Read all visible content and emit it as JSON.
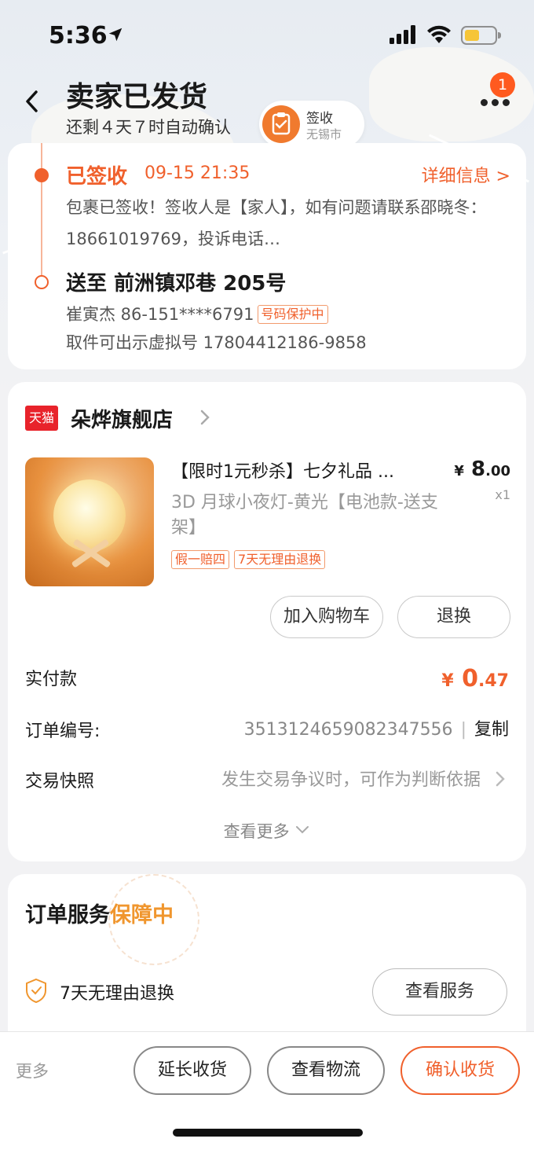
{
  "status_bar": {
    "time": "5:36"
  },
  "header": {
    "title": "卖家已发货",
    "subtitle": "还剩４天７时自动确认",
    "chip_label": "签收",
    "chip_city": "无锡市",
    "notification_count": "1"
  },
  "logistics": {
    "status": "已签收",
    "time": "09-15 21:35",
    "detail_link": "详细信息 >",
    "description": "包裹已签收！签收人是【家人】，如有问题请联系邵晓冬：18661019769，投诉电话…",
    "destination": "送至 前洲镇邓巷 205号",
    "receiver": "崔寅杰 86-151****6791",
    "protect_tag": "号码保护中",
    "pickup": "取件可出示虚拟号 17804412186-9858"
  },
  "order": {
    "shop_badge": "天猫",
    "shop_name": "朵烨旗舰店",
    "product_title": "【限时1元秒杀】七夕礼品 ...",
    "price_yen": "¥",
    "price_int": "8",
    "price_dec": ".00",
    "quantity": "x1",
    "sku": "3D 月球小夜灯-黄光【电池款-送支架】",
    "tags": [
      "假一赔四",
      "7天无理由退换"
    ],
    "add_to_cart": "加入购物车",
    "return_exchange": "退换",
    "paid_label": "实付款",
    "paid_yen": "¥",
    "paid_int": "0",
    "paid_dec": ".47",
    "order_no_label": "订单编号:",
    "order_no": "3513124659082347556",
    "copy_label": "复制",
    "snapshot_label": "交易快照",
    "snapshot_hint": "发生交易争议时，可作为判断依据",
    "see_more": "查看更多"
  },
  "service": {
    "title": "订单服务",
    "title_highlight": "保障中",
    "item": "7天无理由退换",
    "view_button": "查看服务"
  },
  "bottom_bar": {
    "more": "更多",
    "extend": "延长收货",
    "track": "查看物流",
    "confirm": "确认收货"
  },
  "colors": {
    "accent": "#f0602c",
    "highlight": "#f0962e",
    "tmall_red": "#e8232b"
  }
}
